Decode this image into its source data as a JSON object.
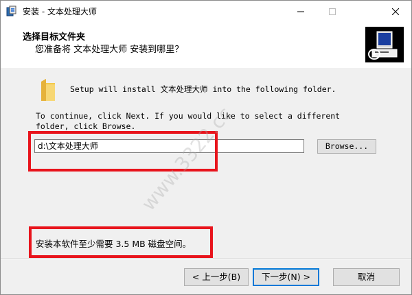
{
  "window": {
    "title": "安装 - 文本处理大师"
  },
  "header": {
    "title": "选择目标文件夹",
    "subtitle": "您准备将 文本处理大师 安装到哪里？"
  },
  "body": {
    "setup_message": "Setup will install 文本处理大师 into the following folder.",
    "continue_message": "To continue, click Next. If you would like to select a different\nfolder, click Browse.",
    "path_value": "d:\\文本处理大师",
    "browse_label": "Browse...",
    "disk_space_message": "安装本软件至少需要 3.5 MB 磁盘空间。"
  },
  "watermark": "www.3322.cc",
  "watermark_cn": "3322软件站",
  "buttons": {
    "back": "< 上一步(B)",
    "next": "下一步(N) >",
    "cancel": "取消"
  },
  "colors": {
    "highlight_box": "#e8141c",
    "default_button_border": "#0078d7"
  },
  "icons": {
    "app": "installer-icon",
    "folder": "folder-icon",
    "wizard": "computer-install-icon"
  }
}
